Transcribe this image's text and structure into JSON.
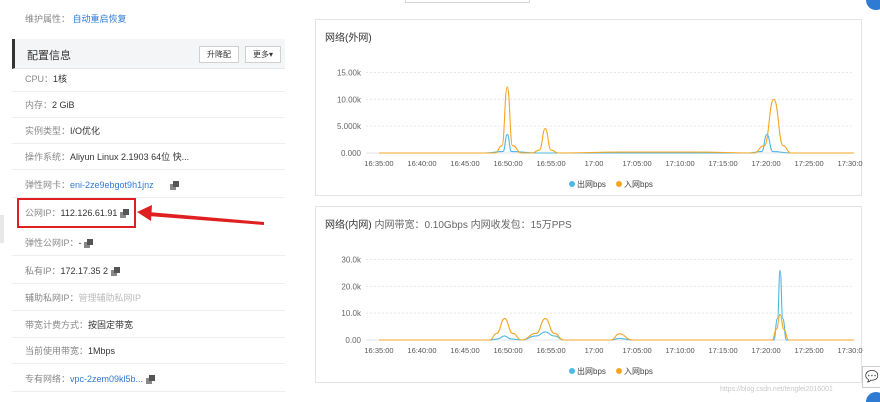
{
  "maintenance": {
    "label": "维护属性：",
    "value": "自动重启恢复"
  },
  "config": {
    "title": "配置信息",
    "upgrade_btn": "升降配",
    "more_btn": "更多▾"
  },
  "rows": [
    {
      "k": "CPU：",
      "v": "1核"
    },
    {
      "k": "内存：",
      "v": "2 GiB"
    },
    {
      "k": "实例类型：",
      "v": "I/O优化"
    },
    {
      "k": "操作系统：",
      "v": "Aliyun Linux 2.1903 64位 快..."
    },
    {
      "k": "弹性网卡：",
      "v": "eni-2ze9ebgot9h1jnz"
    },
    {
      "k": "公网IP：",
      "v": "112.126.61.91"
    },
    {
      "k": "弹性公网IP：",
      "v": "-"
    },
    {
      "k": "私有IP：",
      "v": "172.17.35    2"
    },
    {
      "k": "辅助私网IP：",
      "v": "管理辅助私网IP"
    },
    {
      "k": "带宽计费方式：",
      "v": "按固定带宽"
    },
    {
      "k": "当前使用带宽：",
      "v": "1Mbps"
    },
    {
      "k": "专有网络：",
      "v": "vpc-2zem09kl5b..."
    }
  ],
  "charts": {
    "outer": {
      "title": "网络(外网)",
      "subtitle": ""
    },
    "inner": {
      "title": "网络(内网)",
      "subtitle": "内网带宽：0.10Gbps 内网收发包：15万PPS"
    },
    "legend_out": "出网bps",
    "legend_in": "入网bps",
    "color_out": "#4cb8e6",
    "color_in": "#f5a623"
  },
  "chart_data": [
    {
      "type": "line",
      "title": "网络(外网)",
      "x": [
        "16:35:00",
        "16:40:00",
        "16:45:00",
        "16:50:00",
        "16:55:00",
        "17:00",
        "17:05:00",
        "17:10:00",
        "17:15:00",
        "17:20:00",
        "17:25:00",
        "17:30:00"
      ],
      "yticks": [
        "0.000",
        "5.000k",
        "10.00k",
        "15.00k"
      ],
      "ylim": [
        0,
        17000
      ],
      "series": [
        {
          "name": "出网bps",
          "points": [
            [
              0,
              0
            ],
            [
              20,
              0
            ],
            [
              23.5,
              300
            ],
            [
              24.3,
              3800
            ],
            [
              25.1,
              300
            ],
            [
              30,
              0
            ],
            [
              46,
              0
            ],
            [
              60,
              0
            ],
            [
              70,
              0
            ],
            [
              72.5,
              300
            ],
            [
              73.5,
              3800
            ],
            [
              74.6,
              300
            ],
            [
              78,
              0
            ],
            [
              90,
              0
            ]
          ]
        },
        {
          "name": "入网bps",
          "points": [
            [
              0,
              0
            ],
            [
              22,
              0
            ],
            [
              23.3,
              1500
            ],
            [
              24.3,
              13500
            ],
            [
              25.3,
              1500
            ],
            [
              27,
              0
            ],
            [
              29,
              0
            ],
            [
              30.4,
              600
            ],
            [
              31.5,
              5000
            ],
            [
              32.6,
              600
            ],
            [
              34,
              0
            ],
            [
              46,
              200
            ],
            [
              60,
              200
            ],
            [
              71,
              0
            ],
            [
              73,
              1500
            ],
            [
              74.8,
              11000
            ],
            [
              76.6,
              1500
            ],
            [
              78,
              0
            ],
            [
              90,
              0
            ]
          ]
        }
      ],
      "legend": "bottom"
    },
    {
      "type": "line",
      "title": "网络(内网)",
      "x": [
        "16:35:00",
        "16:40:00",
        "16:45:00",
        "16:50:00",
        "16:55:00",
        "17:00",
        "17:05:00",
        "17:10:00",
        "17:15:00",
        "17:20:00",
        "17:25:00",
        "17:30:00"
      ],
      "yticks": [
        "0.00",
        "10.0k",
        "20.0k",
        "30.0k"
      ],
      "ylim": [
        0,
        31000
      ],
      "series": [
        {
          "name": "出网bps",
          "points": [
            [
              0,
              0
            ],
            [
              21,
              0
            ],
            [
              22.5,
              400
            ],
            [
              23.8,
              1500
            ],
            [
              25,
              400
            ],
            [
              27,
              0
            ],
            [
              29.8,
              1500
            ],
            [
              31.5,
              3000
            ],
            [
              33.2,
              1500
            ],
            [
              35,
              0
            ],
            [
              44,
              0
            ],
            [
              45.5,
              600
            ],
            [
              48,
              0
            ],
            [
              60,
              0
            ],
            [
              74.8,
              0
            ],
            [
              75.5,
              8000
            ],
            [
              76,
              26000
            ],
            [
              76.5,
              8000
            ],
            [
              77.2,
              0
            ],
            [
              90,
              0
            ]
          ]
        },
        {
          "name": "入网bps",
          "points": [
            [
              0,
              0
            ],
            [
              21,
              0
            ],
            [
              22.3,
              2500
            ],
            [
              23.8,
              8000
            ],
            [
              25.3,
              2500
            ],
            [
              27,
              0
            ],
            [
              29.8,
              2500
            ],
            [
              31.5,
              8000
            ],
            [
              33.2,
              2500
            ],
            [
              35,
              0
            ],
            [
              44,
              0
            ],
            [
              45.5,
              2300
            ],
            [
              48,
              0
            ],
            [
              60,
              0
            ],
            [
              74.5,
              0
            ],
            [
              75.3,
              4000
            ],
            [
              76,
              9500
            ],
            [
              76.7,
              4000
            ],
            [
              77.6,
              0
            ],
            [
              90,
              0
            ]
          ]
        }
      ],
      "legend": "bottom"
    }
  ],
  "watermark": "https://blog.csdn.net/tengfei2016001"
}
